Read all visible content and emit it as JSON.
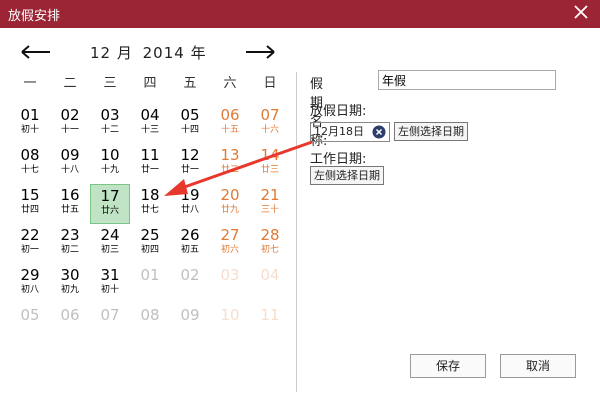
{
  "window": {
    "title": "放假安排"
  },
  "calendar": {
    "year_text": "2014 年",
    "month_text": "12 月",
    "weekdays": [
      "一",
      "二",
      "三",
      "四",
      "五",
      "六",
      "日"
    ],
    "rows": [
      [
        [
          "01",
          "初十",
          0
        ],
        [
          "02",
          "十一",
          0
        ],
        [
          "03",
          "十二",
          0
        ],
        [
          "04",
          "十三",
          0
        ],
        [
          "05",
          "十四",
          0
        ],
        [
          "06",
          "十五",
          1
        ],
        [
          "07",
          "十六",
          1
        ]
      ],
      [
        [
          "08",
          "十七",
          0
        ],
        [
          "09",
          "十八",
          0
        ],
        [
          "10",
          "十九",
          0
        ],
        [
          "11",
          "廿一",
          0
        ],
        [
          "12",
          "廿一",
          0
        ],
        [
          "13",
          "廿二",
          1
        ],
        [
          "14",
          "廿三",
          1
        ]
      ],
      [
        [
          "15",
          "廿四",
          0
        ],
        [
          "16",
          "廿五",
          0
        ],
        [
          "17",
          "廿六",
          0
        ],
        [
          "18",
          "廿七",
          0
        ],
        [
          "19",
          "廿八",
          0
        ],
        [
          "20",
          "廿九",
          1
        ],
        [
          "21",
          "三十",
          1
        ]
      ],
      [
        [
          "22",
          "初一",
          0
        ],
        [
          "23",
          "初二",
          0
        ],
        [
          "24",
          "初三",
          0
        ],
        [
          "25",
          "初四",
          0
        ],
        [
          "26",
          "初五",
          0
        ],
        [
          "27",
          "初六",
          1
        ],
        [
          "28",
          "初七",
          1
        ]
      ],
      [
        [
          "29",
          "初八",
          0
        ],
        [
          "30",
          "初九",
          0
        ],
        [
          "31",
          "初十",
          0
        ],
        [
          "01",
          "",
          0
        ],
        [
          "02",
          "",
          0
        ],
        [
          "03",
          "",
          1
        ],
        [
          "04",
          "",
          1
        ]
      ],
      [
        [
          "05",
          "",
          0
        ],
        [
          "06",
          "",
          0
        ],
        [
          "07",
          "",
          0
        ],
        [
          "08",
          "",
          0
        ],
        [
          "09",
          "",
          0
        ],
        [
          "10",
          "",
          1
        ],
        [
          "11",
          "",
          1
        ]
      ]
    ],
    "selected_day": "17"
  },
  "form": {
    "name_label": "假期名称:",
    "name_value": "年假",
    "holiday_label": "放假日期:",
    "holiday_chip": "12月18日",
    "pick_button": "左侧选择日期",
    "work_label": "工作日期:",
    "work_pick_button": "左侧选择日期"
  },
  "buttons": {
    "save": "保存",
    "cancel": "取消"
  },
  "colors": {
    "titlebar": "#9b2535",
    "weekend": "#e07a35",
    "selected": "#bfe3c4",
    "pointer": "#e8372c"
  }
}
